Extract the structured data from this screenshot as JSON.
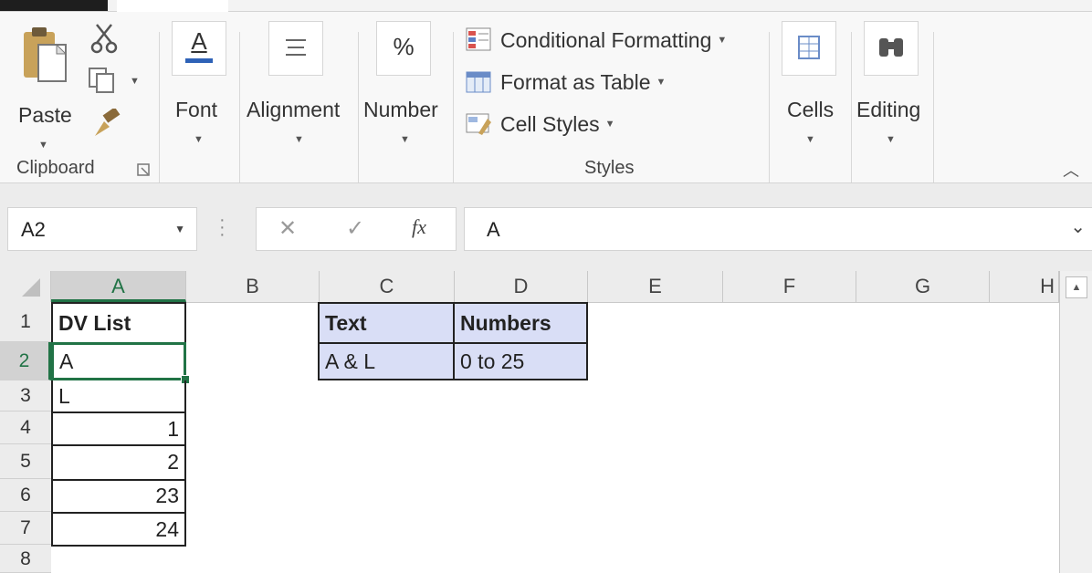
{
  "ribbon": {
    "clipboard": {
      "paste_label": "Paste",
      "group_label": "Clipboard"
    },
    "font": {
      "label": "Font"
    },
    "alignment": {
      "label": "Alignment"
    },
    "number": {
      "label": "Number",
      "icon_text": "%"
    },
    "styles": {
      "conditional_formatting": "Conditional Formatting",
      "format_as_table": "Format as Table",
      "cell_styles": "Cell Styles",
      "group_label": "Styles"
    },
    "cells": {
      "label": "Cells"
    },
    "editing": {
      "label": "Editing"
    },
    "font_icon_text": "A"
  },
  "formula_bar": {
    "name_box": "A2",
    "content": "A",
    "fx_label": "fx"
  },
  "columns": [
    "A",
    "B",
    "C",
    "D",
    "E",
    "F",
    "G",
    "H"
  ],
  "rows": [
    "1",
    "2",
    "3",
    "4",
    "5",
    "6",
    "7",
    "8"
  ],
  "cells": {
    "A1": "DV List",
    "A2": "A",
    "A3": "L",
    "A4": "1",
    "A5": "2",
    "A6": "23",
    "A7": "24",
    "C1": "Text",
    "D1": "Numbers",
    "C2": "A & L",
    "D2": "0 to 25"
  },
  "colors": {
    "selection_green": "#217346",
    "table_fill": "#d9def6",
    "header_gray": "#ececec"
  }
}
